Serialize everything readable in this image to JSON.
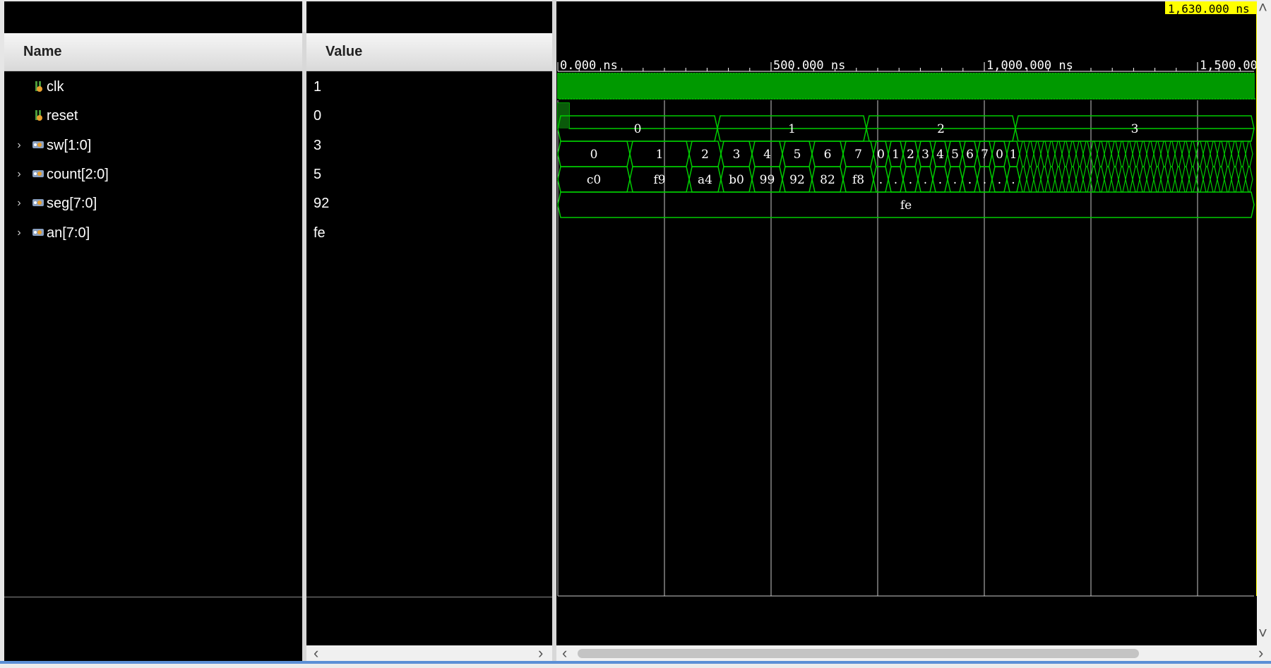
{
  "columns": {
    "name": "Name",
    "value": "Value"
  },
  "signals": [
    {
      "name": "clk",
      "value": "1",
      "icon": "bit-signal-icon",
      "expandable": false
    },
    {
      "name": "reset",
      "value": "0",
      "icon": "bit-signal-icon",
      "expandable": false
    },
    {
      "name": "sw[1:0]",
      "value": "3",
      "icon": "bus-signal-icon",
      "expandable": true
    },
    {
      "name": "count[2:0]",
      "value": "5",
      "icon": "bus-signal-icon",
      "expandable": true
    },
    {
      "name": "seg[7:0]",
      "value": "92",
      "icon": "bus-signal-icon",
      "expandable": true
    },
    {
      "name": "an[7:0]",
      "value": "fe",
      "icon": "bus-signal-icon",
      "expandable": true
    }
  ],
  "ruler": {
    "labels": [
      "0.000 ns",
      "500.000 ns",
      "1,000.000 ns",
      "1,500.00"
    ],
    "marker_time": "1,630.000 ns",
    "times_ns": [
      0,
      500,
      1000,
      1500
    ]
  },
  "waveforms": {
    "sw": [
      "0",
      "1",
      "2",
      "3"
    ],
    "count": [
      "0",
      "1",
      "2",
      "3",
      "4",
      "5",
      "6",
      "7",
      "0",
      "1",
      "2",
      "3",
      "4",
      "5",
      "6",
      "7",
      "0",
      "1"
    ],
    "seg": [
      "c0",
      "f9",
      "a4",
      "b0",
      "99",
      "92",
      "82",
      "f8",
      ".",
      ".",
      ".",
      ".",
      ".",
      ".",
      ".",
      ".",
      ".",
      "."
    ],
    "an": [
      "fe"
    ]
  },
  "colors": {
    "waveform": "#00cc00",
    "background": "#000000",
    "marker": "#ffff00",
    "grid": "#c8c8c8"
  }
}
